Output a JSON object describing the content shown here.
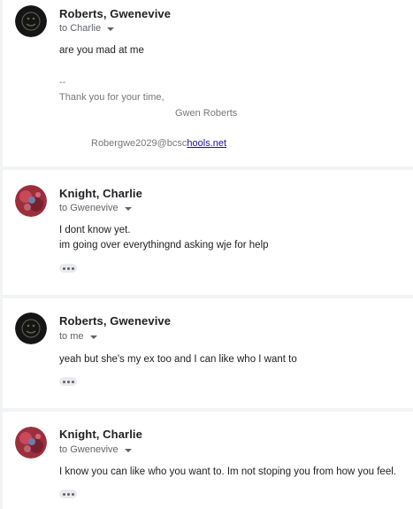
{
  "messages": [
    {
      "sender": "Roberts, Gwenevive",
      "recipient": "to Charlie",
      "avatar_icon": "smiley-avatar-icon",
      "body": [
        "are you mad at me"
      ],
      "signature": {
        "separator": "--",
        "thanks": "Thank you for your time,",
        "name": "Gwen Roberts",
        "email_prefix": "Robergwe2029@bcsc",
        "email_link": "hools.net"
      }
    },
    {
      "sender": "Knight, Charlie",
      "recipient": "to Gwenevive",
      "avatar_icon": "photo-avatar-icon",
      "body": [
        "I dont know yet.",
        "im going over everythingnd asking wje for help"
      ]
    },
    {
      "sender": "Roberts, Gwenevive",
      "recipient": "to me",
      "avatar_icon": "smiley-avatar-icon",
      "body": [
        "yeah but she's my ex too and I can like who I want to"
      ]
    },
    {
      "sender": "Knight, Charlie",
      "recipient": "to Gwenevive",
      "avatar_icon": "photo-avatar-icon",
      "body": [
        "I know you can like who you want to. Im not stoping you from how you feel."
      ]
    }
  ],
  "colors": {
    "background": "#f1f3f4",
    "card": "#ffffff",
    "link": "#1a0dab"
  }
}
